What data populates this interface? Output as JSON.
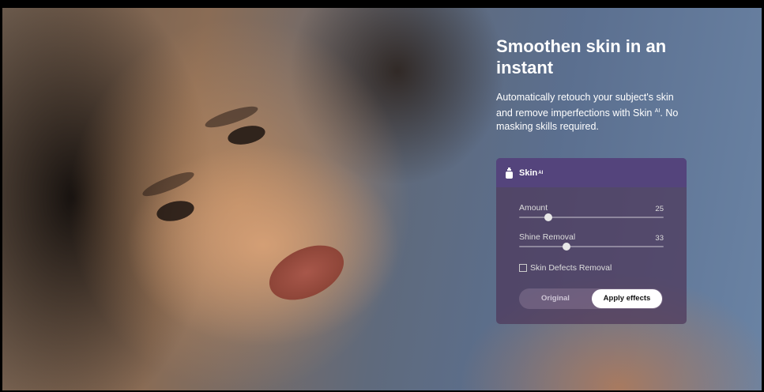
{
  "hero": {
    "headline": "Smoothen skin in an instant",
    "description_pre": "Automatically retouch your subject's skin and remove imperfections with Skin",
    "description_sup": "AI",
    "description_post": ". No masking skills required."
  },
  "panel": {
    "title": "Skin",
    "title_sup": "AI",
    "icon": "bottle-icon",
    "sliders": [
      {
        "label": "Amount",
        "value": "25",
        "fraction": 0.2
      },
      {
        "label": "Shine Removal",
        "value": "33",
        "fraction": 0.33
      }
    ],
    "checkbox": {
      "label": "Skin Defects Removal",
      "checked": false
    },
    "toggle": {
      "original": "Original",
      "apply": "Apply effects",
      "selected": "apply"
    }
  }
}
